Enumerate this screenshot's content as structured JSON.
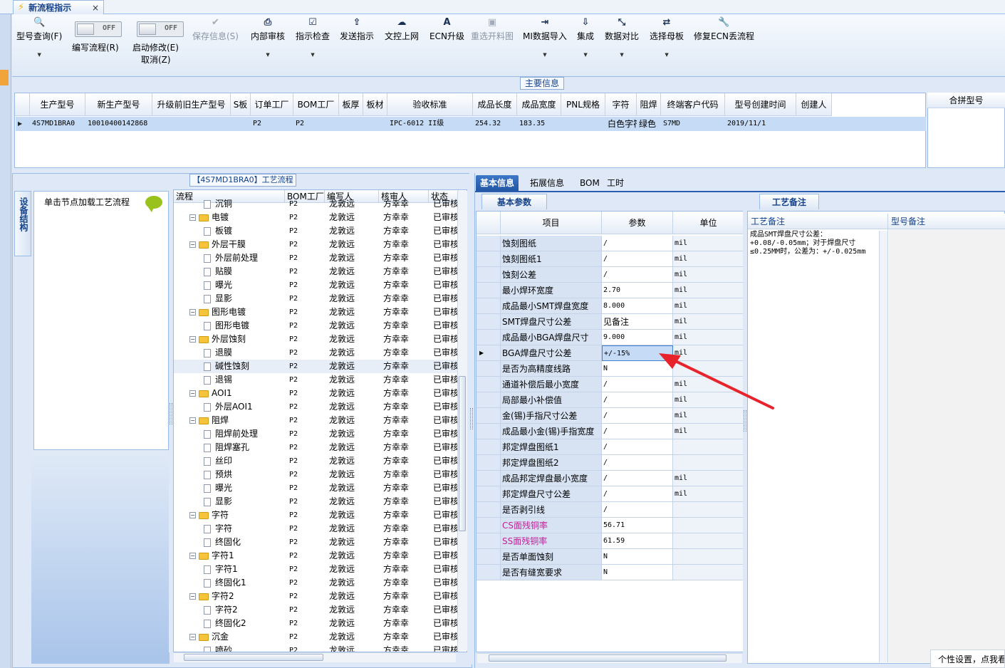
{
  "window_tab": {
    "title": "新流程指示",
    "close": "×"
  },
  "toolbar": {
    "buttons": [
      {
        "label": "型号查询(F)",
        "icon": "search-icon",
        "glyph": "🔍"
      },
      {
        "label": "保存信息(S)",
        "icon": "check-icon",
        "glyph": "✔",
        "disabled": true
      },
      {
        "label": "内部审核",
        "icon": "printer-icon",
        "glyph": "⎙"
      },
      {
        "label": "指示检查",
        "icon": "checklist-icon",
        "glyph": "☑"
      },
      {
        "label": "发送指示",
        "icon": "upload-icon",
        "glyph": "⇪"
      },
      {
        "label": "文控上网",
        "icon": "cloud-upload-icon",
        "glyph": "☁"
      },
      {
        "label": "ECN升级",
        "icon": "ecn-icon",
        "glyph": "A"
      },
      {
        "label": "重选开料图",
        "icon": "image-icon",
        "glyph": "▣",
        "disabled": true
      },
      {
        "label": "MI数据导入",
        "icon": "import-icon",
        "glyph": "⇥"
      },
      {
        "label": "集成",
        "icon": "download-icon",
        "glyph": "⇩"
      },
      {
        "label": "数据对比",
        "icon": "compare-icon",
        "glyph": "⤡"
      },
      {
        "label": "选择母板",
        "icon": "shuffle-icon",
        "glyph": "⇄"
      },
      {
        "label": "修复ECN丢流程",
        "icon": "wrench-icon",
        "glyph": "🔧"
      }
    ],
    "toggles": [
      {
        "state": "OFF",
        "label": "编写流程(R)"
      },
      {
        "state": "OFF",
        "label": "启动修改(E)",
        "label2": "取消(Z)"
      }
    ]
  },
  "main_info": {
    "title": "主要信息",
    "columns": [
      "生产型号",
      "新生产型号",
      "升级前旧生产型号",
      "S板",
      "订单工厂",
      "BOM工厂",
      "板厚",
      "板材",
      "验收标准",
      "成品长度",
      "成品宽度",
      "PNL规格",
      "字符",
      "阻焊",
      "终端客户代码",
      "型号创建时间",
      "创建人"
    ],
    "row": [
      "4S7MD1BRA0",
      "10010400142868",
      "",
      "",
      "P2",
      "P2",
      "",
      "",
      "IPC-6012 II级",
      "254.32",
      "183.35",
      "",
      "白色字符",
      "绿色",
      "S7MD",
      "2019/11/1",
      ""
    ],
    "merge_header": "合拼型号"
  },
  "flow_panel": {
    "title": "【4S7MD1BRA0】工艺流程",
    "side_tab": "设备结构",
    "node_hint": "单击节点加载工艺流程",
    "columns": [
      "流程",
      "BOM工厂",
      "编写人",
      "核审人",
      "状态"
    ],
    "default_factory": "P2",
    "default_writer": "龙敦远",
    "default_reviewer": "方幸幸",
    "default_status": "已审核",
    "rows": [
      {
        "name": "沉铜",
        "level": 1
      },
      {
        "name": "电镀",
        "level": 0
      },
      {
        "name": "板镀",
        "level": 1
      },
      {
        "name": "外层干膜",
        "level": 0
      },
      {
        "name": "外层前处理",
        "level": 1
      },
      {
        "name": "贴膜",
        "level": 1
      },
      {
        "name": "曝光",
        "level": 1
      },
      {
        "name": "显影",
        "level": 1
      },
      {
        "name": "图形电镀",
        "level": 0
      },
      {
        "name": "图形电镀",
        "level": 1
      },
      {
        "name": "外层蚀刻",
        "level": 0
      },
      {
        "name": "退膜",
        "level": 1
      },
      {
        "name": "碱性蚀刻",
        "level": 1,
        "selected": true
      },
      {
        "name": "退锡",
        "level": 1
      },
      {
        "name": "AOI1",
        "level": 0
      },
      {
        "name": "外层AOI1",
        "level": 1
      },
      {
        "name": "阻焊",
        "level": 0
      },
      {
        "name": "阻焊前处理",
        "level": 1
      },
      {
        "name": "阻焊塞孔",
        "level": 1
      },
      {
        "name": "丝印",
        "level": 1
      },
      {
        "name": "预烘",
        "level": 1
      },
      {
        "name": "曝光",
        "level": 1
      },
      {
        "name": "显影",
        "level": 1
      },
      {
        "name": "字符",
        "level": 0
      },
      {
        "name": "字符",
        "level": 1
      },
      {
        "name": "终固化",
        "level": 1
      },
      {
        "name": "字符1",
        "level": 0
      },
      {
        "name": "字符1",
        "level": 1
      },
      {
        "name": "终固化1",
        "level": 1
      },
      {
        "name": "字符2",
        "level": 0
      },
      {
        "name": "字符2",
        "level": 1
      },
      {
        "name": "终固化2",
        "level": 1
      },
      {
        "name": "沉金",
        "level": 0
      },
      {
        "name": "喷砂",
        "level": 1
      }
    ]
  },
  "right_tabs": [
    "基本信息",
    "拓展信息",
    "BOM",
    "工时"
  ],
  "params": {
    "tab": "基本参数",
    "columns": [
      "项目",
      "参数",
      "单位"
    ],
    "rows": [
      {
        "item": "蚀刻图纸",
        "value": "/",
        "unit": "mil"
      },
      {
        "item": "蚀刻图纸1",
        "value": "/",
        "unit": "mil"
      },
      {
        "item": "蚀刻公差",
        "value": "/",
        "unit": "mil"
      },
      {
        "item": "最小焊环宽度",
        "value": "2.70",
        "unit": "mil"
      },
      {
        "item": "成品最小SMT焊盘宽度",
        "value": "8.000",
        "unit": "mil"
      },
      {
        "item": "SMT焊盘尺寸公差",
        "value": "见备注",
        "unit": "mil"
      },
      {
        "item": "成品最小BGA焊盘尺寸",
        "value": "9.000",
        "unit": "mil"
      },
      {
        "item": "BGA焊盘尺寸公差",
        "value": "+/-15%",
        "unit": "mil",
        "selected": true
      },
      {
        "item": "是否为高精度线路",
        "value": "N",
        "unit": ""
      },
      {
        "item": "通道补偿后最小宽度",
        "value": "/",
        "unit": "mil"
      },
      {
        "item": "局部最小补偿值",
        "value": "/",
        "unit": "mil"
      },
      {
        "item": "金(锡)手指尺寸公差",
        "value": "/",
        "unit": "mil"
      },
      {
        "item": "成品最小金(锡)手指宽度",
        "value": "/",
        "unit": "mil"
      },
      {
        "item": "邦定焊盘图纸1",
        "value": "/",
        "unit": ""
      },
      {
        "item": "邦定焊盘图纸2",
        "value": "/",
        "unit": ""
      },
      {
        "item": "成品邦定焊盘最小宽度",
        "value": "/",
        "unit": "mil"
      },
      {
        "item": "邦定焊盘尺寸公差",
        "value": "/",
        "unit": "mil"
      },
      {
        "item": "是否剥引线",
        "value": "/",
        "unit": ""
      },
      {
        "item": "CS面残铜率",
        "value": "56.71",
        "unit": "",
        "pink": true
      },
      {
        "item": "SS面残铜率",
        "value": "61.59",
        "unit": "",
        "pink": true
      },
      {
        "item": "是否单面蚀刻",
        "value": "N",
        "unit": ""
      },
      {
        "item": "是否有缝宽要求",
        "value": "N",
        "unit": ""
      }
    ]
  },
  "notes": {
    "tab": "工艺备注",
    "col1": "工艺备注",
    "col2": "型号备注",
    "text": "成品SMT焊盘尺寸公差：+0.08/-0.05mm；对于焊盘尺寸≤0.25MM时，公差为：+/-0.025mm"
  },
  "status_tip": "个性设置，点我看",
  "colors": {
    "accent": "#2156a5",
    "annotation_arrow": "#e8232b"
  }
}
